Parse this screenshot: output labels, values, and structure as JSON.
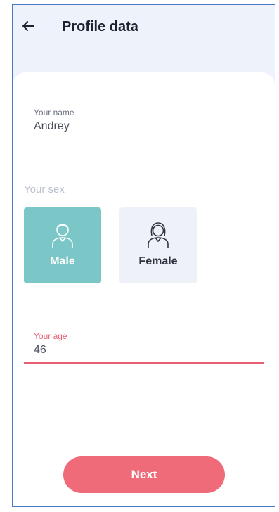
{
  "header": {
    "title": "Profile data",
    "back_icon": "arrow-left-icon"
  },
  "form": {
    "name_label": "Your name",
    "name_value": "Andrey",
    "sex_label": "Your sex",
    "sex_options": [
      {
        "label": "Male",
        "icon": "male-avatar-icon",
        "selected": true
      },
      {
        "label": "Female",
        "icon": "female-avatar-icon",
        "selected": false
      }
    ],
    "age_label": "Your age",
    "age_value": "46"
  },
  "actions": {
    "next_label": "Next"
  },
  "colors": {
    "accent": "#7bc7c7",
    "primary_button": "#ef6b79",
    "error_underline": "#e65f73",
    "header_bg": "#eef3fb"
  }
}
